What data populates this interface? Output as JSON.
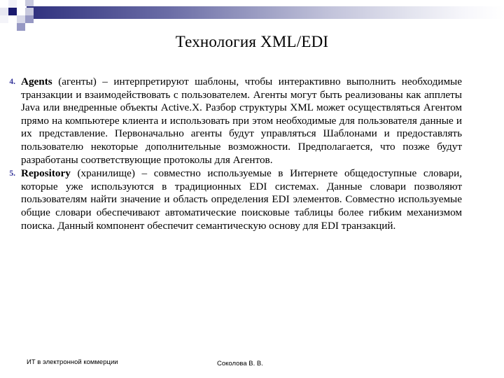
{
  "slide": {
    "title": "Технология XML/EDI",
    "header": {
      "accent_dark": "#2e2f7e",
      "accent_mid": "#9799c4",
      "square_navy": "#1a1a6e"
    },
    "bullets": [
      {
        "marker": "4.",
        "lead": "Agents",
        "rest": " (агенты) – интерпретируют шаблоны, чтобы интерактивно выполнить необходимые транзакции и взаимодействовать с пользователем. Агенты могут быть реализованы как апплеты Java или внедренные объекты Active.X. Разбор структуры XML может осуществляться Агентом прямо на компьютере клиента и использовать при этом необходимые для пользователя данные и их представление. Первоначально агенты будут управляться Шаблонами и предоставлять пользователю некоторые дополнительные возможности. Предполагается, что позже будут разработаны соответствующие протоколы для Агентов."
      },
      {
        "marker": "5.",
        "lead": "Repository",
        "rest": " (хранилище) – совместно используемые в Интернете общедоступные словари, которые уже используются в традиционных EDI системах. Данные словари позволяют пользователям найти значение и область определения EDI элементов. Совместно используемые общие словари обеспечивают автоматические поисковые таблицы более гибким механизмом поиска. Данный компонент обеспечит семантическую основу для EDI транзакций."
      }
    ],
    "footer": {
      "left": "ИТ в электронной коммерции",
      "center": "Соколова В. В."
    }
  }
}
